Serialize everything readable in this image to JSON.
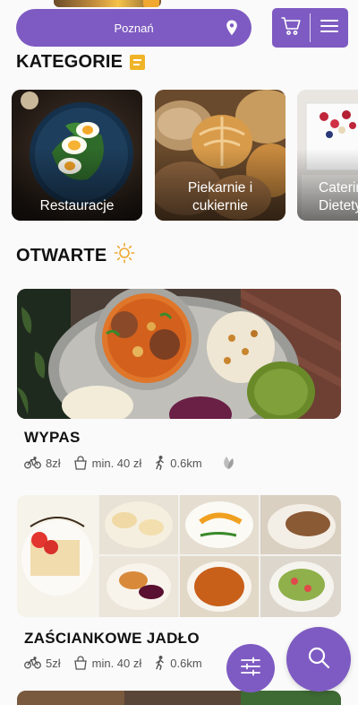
{
  "header": {
    "city": "Poznań",
    "icons": {
      "location": "location-pin-icon",
      "cart": "cart-icon",
      "menu": "hamburger-menu-icon"
    }
  },
  "categories": {
    "title": "KATEGORIE",
    "icon": "note-icon",
    "items": [
      {
        "label": "Restauracje"
      },
      {
        "label": "Piekarnie i cukiernie"
      },
      {
        "label": "Catering Dietetyczny"
      }
    ]
  },
  "open": {
    "title": "OTWARTE",
    "icon": "sun-icon"
  },
  "restaurants": [
    {
      "name": "WYPAS",
      "delivery": "8zł",
      "min_order": "min. 40 zł",
      "distance": "0.6km",
      "extra_icon": "leaf-icon"
    },
    {
      "name": "ZAŚCIANKOWE JADŁO",
      "delivery": "5zł",
      "min_order": "min. 40 zł",
      "distance": "0.6km"
    }
  ],
  "colors": {
    "accent": "#7e5bc2",
    "note": "#f0b429",
    "sun": "#f0a830"
  }
}
